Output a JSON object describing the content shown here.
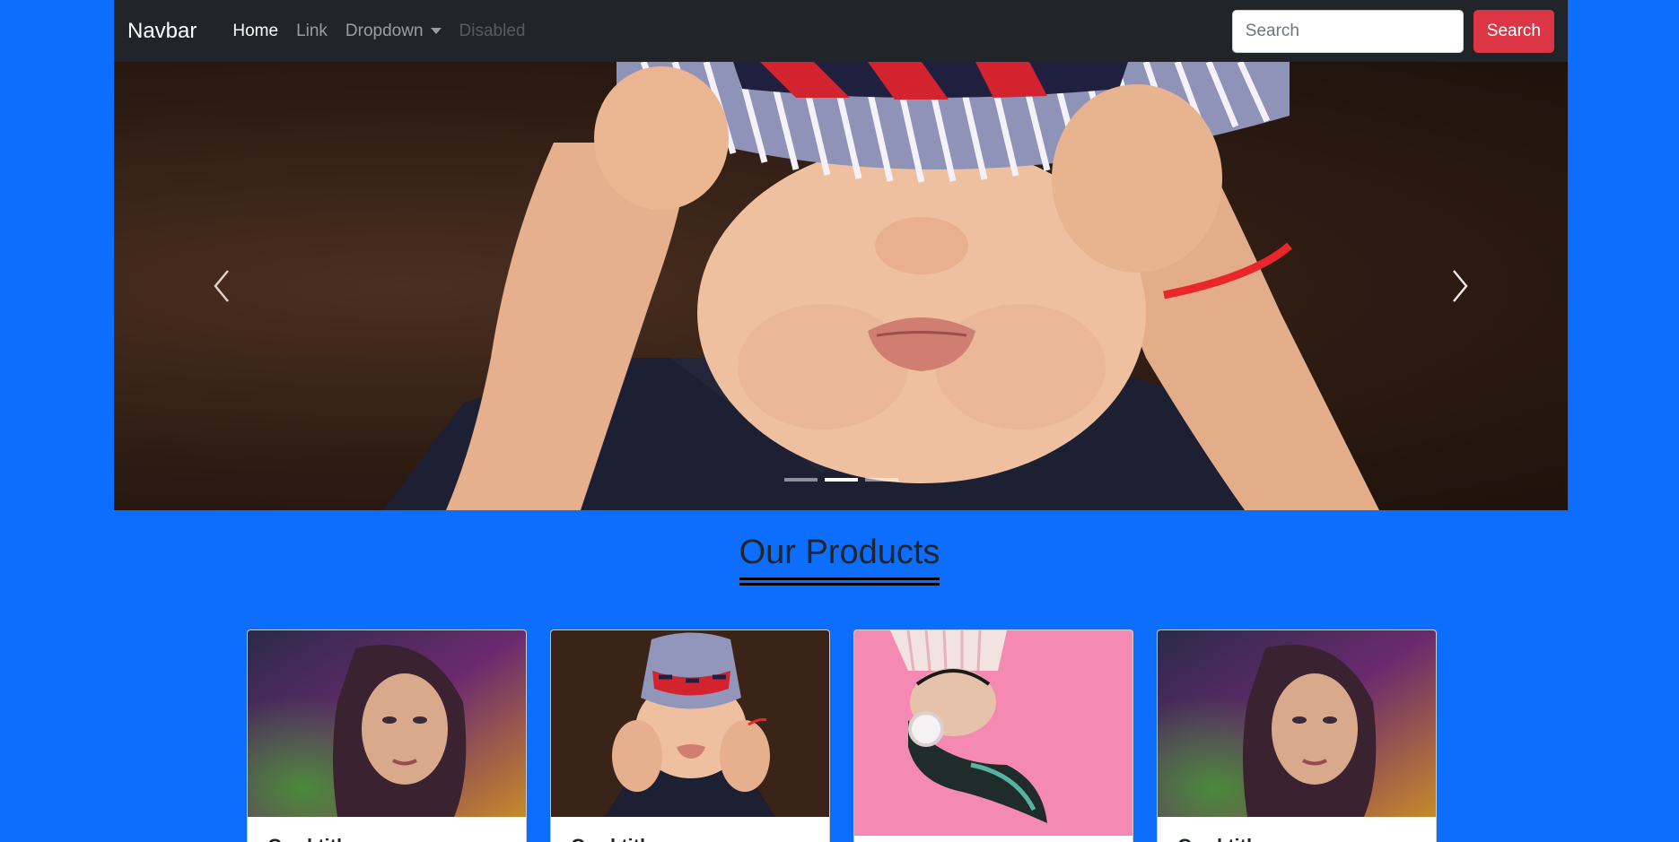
{
  "navbar": {
    "brand": "Navbar",
    "links": [
      {
        "label": "Home",
        "state": "active"
      },
      {
        "label": "Link",
        "state": "normal"
      },
      {
        "label": "Dropdown",
        "state": "dropdown"
      },
      {
        "label": "Disabled",
        "state": "disabled"
      }
    ],
    "search_placeholder": "Search",
    "search_button": "Search"
  },
  "carousel": {
    "active_index": 1,
    "indicator_count": 3,
    "prev_icon": "chevron-left-icon",
    "next_icon": "chevron-right-icon"
  },
  "products": {
    "title": "Our Products",
    "cards": [
      {
        "image": "woman-portrait-colorful",
        "title": "Card title"
      },
      {
        "image": "baby-striped-hat",
        "title": "Card title"
      },
      {
        "image": "girl-headphones-pink",
        "title": ""
      },
      {
        "image": "woman-portrait-colorful",
        "title": "Card title"
      }
    ]
  },
  "colors": {
    "page_bg": "#0d6efd",
    "navbar_bg": "#212529",
    "search_button_bg": "#dc3545"
  }
}
